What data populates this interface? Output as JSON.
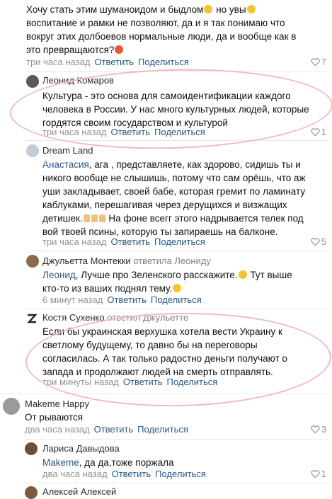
{
  "comments": [
    {
      "text": [
        "Хочу стать этим шуманоидом и быдлом",
        " но увы",
        "",
        "воспитание и рамки не позволяют, да и я так понимаю что",
        "вокруг этих долбоевов нормальные люди, да и вообще как в",
        "это превращаются?"
      ],
      "time": "три часа назад",
      "reply": "Ответить",
      "share": "Поделиться",
      "likes": "7"
    },
    {
      "author": "Леонид Комаров",
      "text": [
        "Культура - это основа для самоидентификации каждого",
        "человека в России. У нас много культурных людей, которые",
        "гордятся своим государством и культурой"
      ],
      "time": "три часа назад",
      "reply": "Ответить",
      "share": "Поделиться",
      "likes": "1"
    },
    {
      "author": "Dream Land",
      "mention": "Анастасия",
      "text": [
        ", ага , представляете, как здорово, сидишь ты и",
        "никого вообще не слышишь, потому что сам орёшь, что аж",
        "уши закладывает, своей бабе, которая гремит по ламинату",
        "каблуками, перешагивая через дерущихся и визжащих",
        "детишек.",
        " На фоне всегг этого надрывается телек под",
        "вой твоей псины, которую ты запираешь на балконе."
      ],
      "time": "три часа назад",
      "reply": "Ответить",
      "share": "Поделиться",
      "likes": "5"
    },
    {
      "author": "Джульетта Монтекки",
      "replied_to": "ответила Леониду",
      "mention": "Леонид",
      "text": [
        ", Лучше про Зеленского расскажите.",
        " Тут выше",
        "кто-то из ваших поднял тему."
      ],
      "time": "6 минут назад",
      "reply": "Ответить",
      "share": "Поделиться"
    },
    {
      "author": "Костя Сухенко",
      "replied_to": "ответил Джульетте",
      "text": [
        "Если бы украинская верхушка хотела вести Украину к",
        "светлому будущему, то давно бы на переговоры",
        "согласилась. А так только радостно деньги получают о",
        "запада и продолжают людей на смерть отправлять."
      ],
      "time": "три минуты назад",
      "reply": "Ответить",
      "share": "Поделиться"
    },
    {
      "author": "Makeme Happy",
      "text": [
        "От рываются"
      ],
      "time": "два часа назад",
      "reply": "Ответить",
      "share": "Поделиться",
      "likes": "3"
    },
    {
      "author": "Лариса Давыдова",
      "mention": "Makeme",
      "text": [
        ", да да,тоже поржала"
      ],
      "time": "два часа назад",
      "reply": "Ответить",
      "share": "Поделиться",
      "likes": "1"
    },
    {
      "author": "Алексей Алексей"
    }
  ],
  "colors": {
    "link": "#2a5885",
    "meta": "#939393",
    "highlight": "#f2b8c6"
  }
}
